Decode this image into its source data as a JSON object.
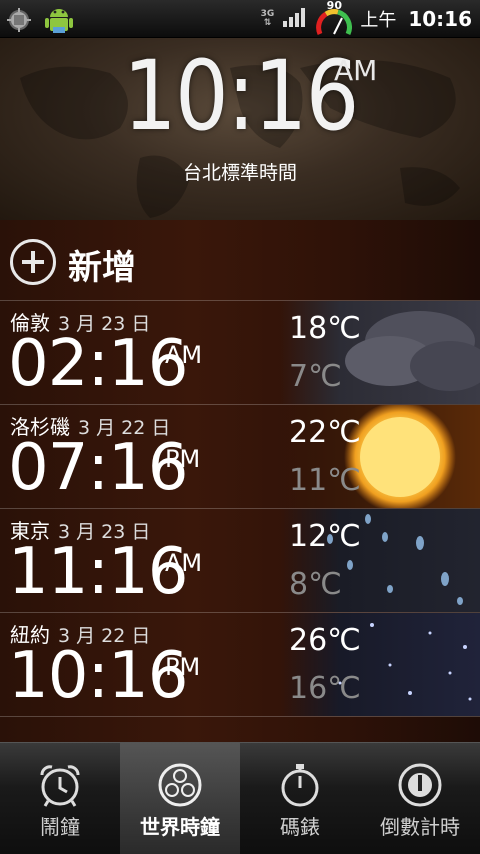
{
  "status_bar": {
    "network": "3G",
    "battery_percent": "90",
    "ampm": "上午",
    "time": "10:16",
    "icons": [
      "settings-notification-icon",
      "android-notification-icon",
      "signal-icon",
      "battery-gauge-icon"
    ]
  },
  "clock": {
    "time": "10:16",
    "ampm": "AM",
    "timezone": "台北標準時間"
  },
  "add": {
    "label": "新增"
  },
  "cities": [
    {
      "name": "倫敦",
      "date": "3 月 23 日",
      "time": "02:16",
      "ampm": "AM",
      "high": "18℃",
      "low": "7℃",
      "weather": "cloudy"
    },
    {
      "name": "洛杉磯",
      "date": "3 月 22 日",
      "time": "07:16",
      "ampm": "PM",
      "high": "22℃",
      "low": "11℃",
      "weather": "sunny"
    },
    {
      "name": "東京",
      "date": "3 月 23 日",
      "time": "11:16",
      "ampm": "AM",
      "high": "12℃",
      "low": "8℃",
      "weather": "rain"
    },
    {
      "name": "紐約",
      "date": "3 月 22 日",
      "time": "10:16",
      "ampm": "PM",
      "high": "26℃",
      "low": "16℃",
      "weather": "clear-night"
    }
  ],
  "tabs": [
    {
      "label": "鬧鐘",
      "icon": "alarm-clock-icon",
      "active": false
    },
    {
      "label": "世界時鐘",
      "icon": "world-clock-icon",
      "active": true
    },
    {
      "label": "碼錶",
      "icon": "stopwatch-icon",
      "active": false
    },
    {
      "label": "倒數計時",
      "icon": "timer-icon",
      "active": false
    }
  ]
}
